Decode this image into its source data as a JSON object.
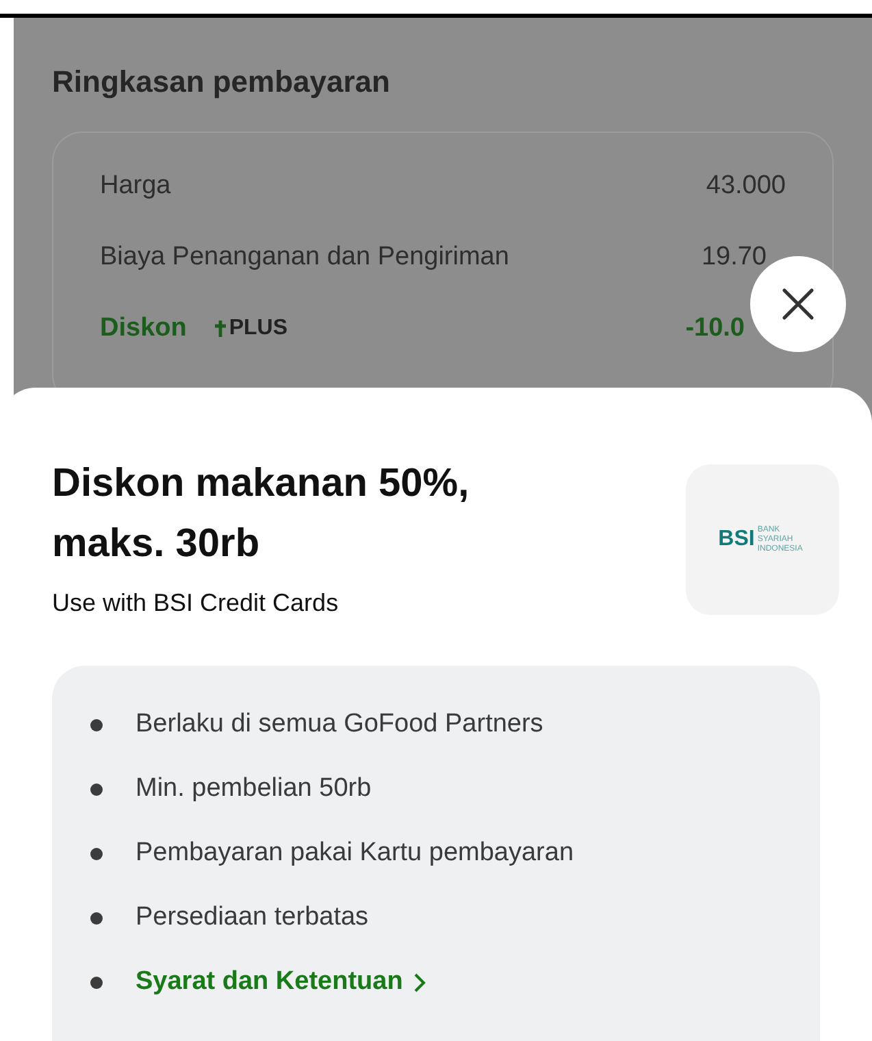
{
  "summary": {
    "title": "Ringkasan pembayaran",
    "rows": [
      {
        "kind": "plain",
        "label": "Harga",
        "value": "43.000"
      },
      {
        "kind": "plain",
        "label": "Biaya Penanganan dan Pengiriman",
        "value": "19.70"
      },
      {
        "kind": "discount",
        "label": "Diskon",
        "badge": "PLUS",
        "value": "-10.0"
      }
    ]
  },
  "sheet": {
    "title": "Diskon makanan 50%, maks. 30rb",
    "subtitle": "Use with BSI Credit Cards",
    "logo": {
      "mark": "BSI",
      "name": "BANK SYARIAH INDONESIA"
    },
    "terms": [
      {
        "kind": "text",
        "text": "Berlaku di semua GoFood Partners"
      },
      {
        "kind": "text",
        "text": "Min. pembelian 50rb"
      },
      {
        "kind": "text",
        "text": "Pembayaran pakai Kartu pembayaran"
      },
      {
        "kind": "text",
        "text": "Persediaan terbatas"
      },
      {
        "kind": "link",
        "text": "Syarat dan Ketentuan"
      }
    ]
  }
}
